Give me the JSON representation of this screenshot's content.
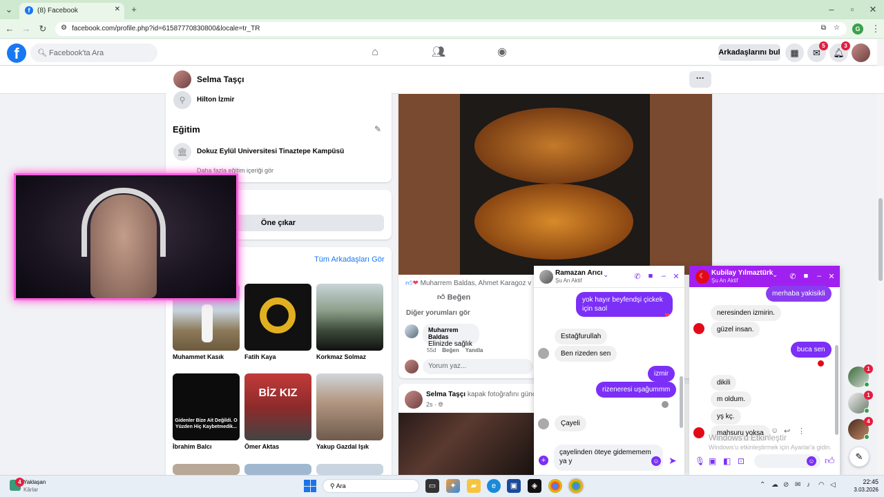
{
  "browser": {
    "tab_title": "(8) Facebook",
    "url": "facebook.com/profile.php?id=61587770830800&locale=tr_TR",
    "profile_letter": "G"
  },
  "fb": {
    "search_placeholder": "Facebook'ta Ara",
    "find_friends": "Arkadaşlarını bul",
    "messenger_badge": "5",
    "notif_badge": "3"
  },
  "profile": {
    "name": "Selma Taşçı",
    "workplace": "Hilton İzmir",
    "education_title": "Eğitim",
    "school": "Dokuz Eylül Universitesi Tinaztepe Kampüsü",
    "more_edu": "Daha fazla eğitim içeriği gör",
    "feature_btn": "Öne çıkar",
    "all_friends": "Tüm Arkadaşları Gör",
    "friends": [
      {
        "name": "Muhammet Kasık"
      },
      {
        "name": "Fatih Kaya"
      },
      {
        "name": "Korkmaz Solmaz"
      },
      {
        "name": "İbrahim Balcı",
        "img_text": "Gidenler Bize Ait Değildi. O Yüzden Hiç Kaybetmedik..."
      },
      {
        "name": "Ömer Aktas",
        "img_text": "BİZ KIZ"
      },
      {
        "name": "Yakup Gazdal Işık"
      }
    ]
  },
  "post": {
    "reactions": "Muharrem Baldas, Ahmet Karagoz v",
    "like": "Beğen",
    "other_comments": "Diğer yorumları gör",
    "commenter": "Muharrem Baldas",
    "comment": "Elinizde sağlık",
    "comment_age": "55d",
    "comment_like": "Beğen",
    "comment_reply": "Yanıtla",
    "write_comment": "Yorum yaz...",
    "post2_author": "Selma Taşçı",
    "post2_action": "kapak fotoğrafını günce",
    "post2_time": "2s"
  },
  "chat1": {
    "name": "Ramazan Arıcı",
    "status": "Şu An Aktif",
    "messages": [
      {
        "dir": "out",
        "text": "yok hayır beyfendşi çickek için saol"
      },
      {
        "dir": "in",
        "text": "Estağfurullah"
      },
      {
        "dir": "in",
        "text": "Ben rizeden sen"
      },
      {
        "dir": "out",
        "text": "izmir"
      },
      {
        "dir": "out",
        "text": "rizeneresi uşağummm"
      },
      {
        "dir": "in",
        "text": "Çayeli"
      }
    ],
    "draft": "çayelinden öteye gidememem ya y"
  },
  "chat2": {
    "name": "Kubilay Yılmaztürk",
    "status": "Şu An Aktif",
    "messages": [
      {
        "dir": "out",
        "text": "merhaba yakisikli"
      },
      {
        "dir": "in",
        "text": "neresinden izmirin."
      },
      {
        "dir": "in",
        "text": "güzel insan."
      },
      {
        "dir": "out",
        "text": "buca sen"
      },
      {
        "dir": "in",
        "text": "dikili"
      },
      {
        "dir": "in",
        "text": "m oldum."
      },
      {
        "dir": "in",
        "text": "yş kç."
      },
      {
        "dir": "in",
        "text": "mahsuru yoksa"
      }
    ],
    "watermark1": "Windows'u Etkinleştir",
    "watermark2": "Windows'u etkinleştirmek için Ayarlar'a gidin."
  },
  "side_badges": [
    "1",
    "1",
    "4"
  ],
  "taskbar": {
    "weather_temp": "Yaklaşan",
    "weather_sub": "Kârlar",
    "weather_badge": "4",
    "search": "Ara",
    "time": "22:45",
    "date": "3.03.2026"
  },
  "colors": {
    "fb_blue": "#1877f2",
    "messenger_purple": "#7b2ff7",
    "chat2_header": "#a020f0",
    "cam_glow": "#ff3fd0"
  }
}
